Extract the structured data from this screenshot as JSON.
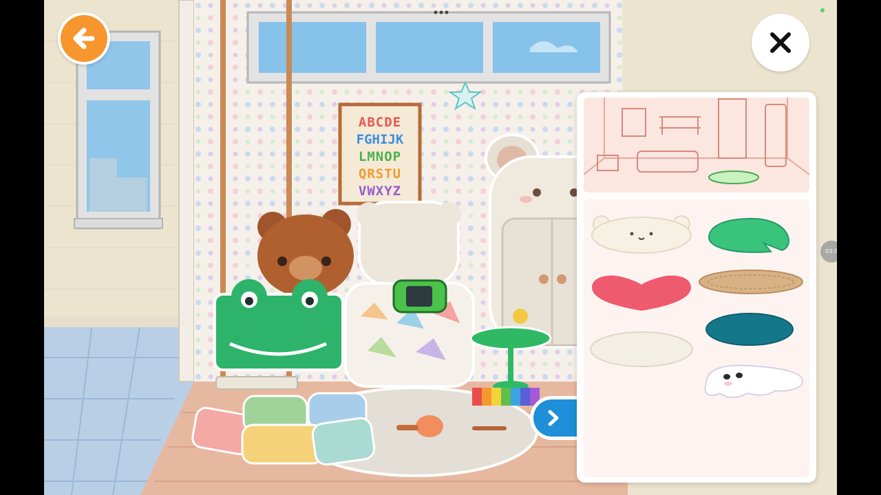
{
  "toolbar": {
    "back_icon": "arrow-left-icon",
    "close_icon": "close-icon",
    "more_icon": "more-dots-icon",
    "next_icon": "chevron-right-icon"
  },
  "status": {
    "time_badge": "03:5"
  },
  "poster": {
    "lines": [
      "ABCDE",
      "FGHIJK",
      "LMNOP",
      "QRSTU",
      "VWXYZ"
    ]
  },
  "panel": {
    "category": "rugs",
    "items": [
      {
        "name": "bear-rug",
        "color": "#f6f1e2"
      },
      {
        "name": "lily-pad-rug",
        "color": "#39c37b"
      },
      {
        "name": "heart-rug",
        "color": "#ef5b6e"
      },
      {
        "name": "woven-oval-rug",
        "color": "#d8b284"
      },
      {
        "name": "white-oval-rug",
        "color": "#f3efe6"
      },
      {
        "name": "teal-oval-rug",
        "color": "#14788a"
      },
      {
        "name": "ghost-rug",
        "color": "#ffffff"
      }
    ]
  },
  "colors": {
    "accent_orange": "#f7962f",
    "accent_blue": "#1e8fd8",
    "panel_bg": "#fdf4f2"
  }
}
